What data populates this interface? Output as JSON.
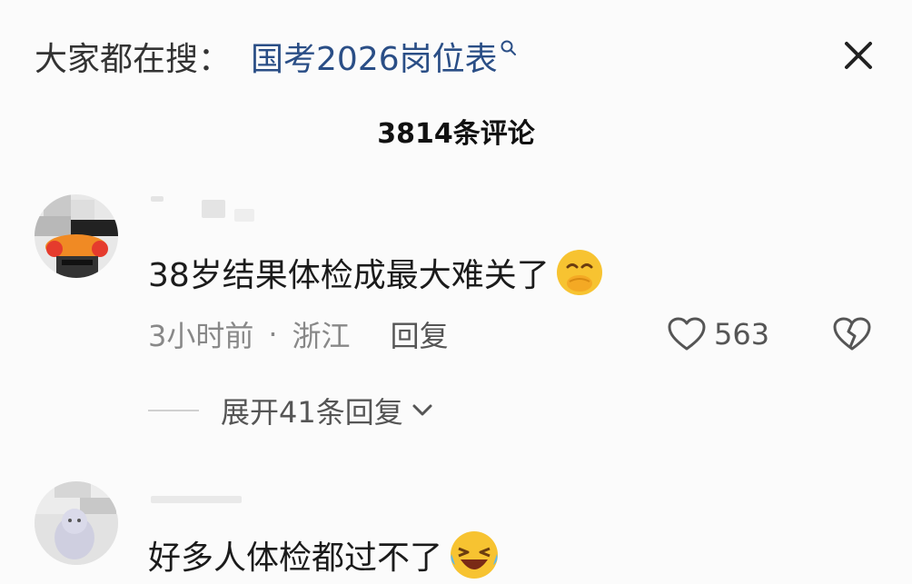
{
  "search_hint": {
    "prefix": "大家都在搜：",
    "query": "国考2026岗位表"
  },
  "header": {
    "comment_count": "3814条评论"
  },
  "comments": [
    {
      "text": "38岁结果体检成最大难关了",
      "emoji": "smirking-hand-over-mouth-emoji",
      "time": "3小时前",
      "location": "浙江",
      "reply_label": "回复",
      "likes": "563",
      "expand_replies": "展开41条回复"
    },
    {
      "text": "好多人体检都过不了",
      "emoji": "laughing-crying-emoji"
    }
  ],
  "icons": {
    "search": "search-icon",
    "close": "close-icon",
    "like": "heart-outline-icon",
    "dislike": "broken-heart-icon",
    "expand": "chevron-down-icon"
  },
  "colors": {
    "link": "#2a4e86",
    "meta": "#888888",
    "emoji_yellow": "#f7c331"
  }
}
